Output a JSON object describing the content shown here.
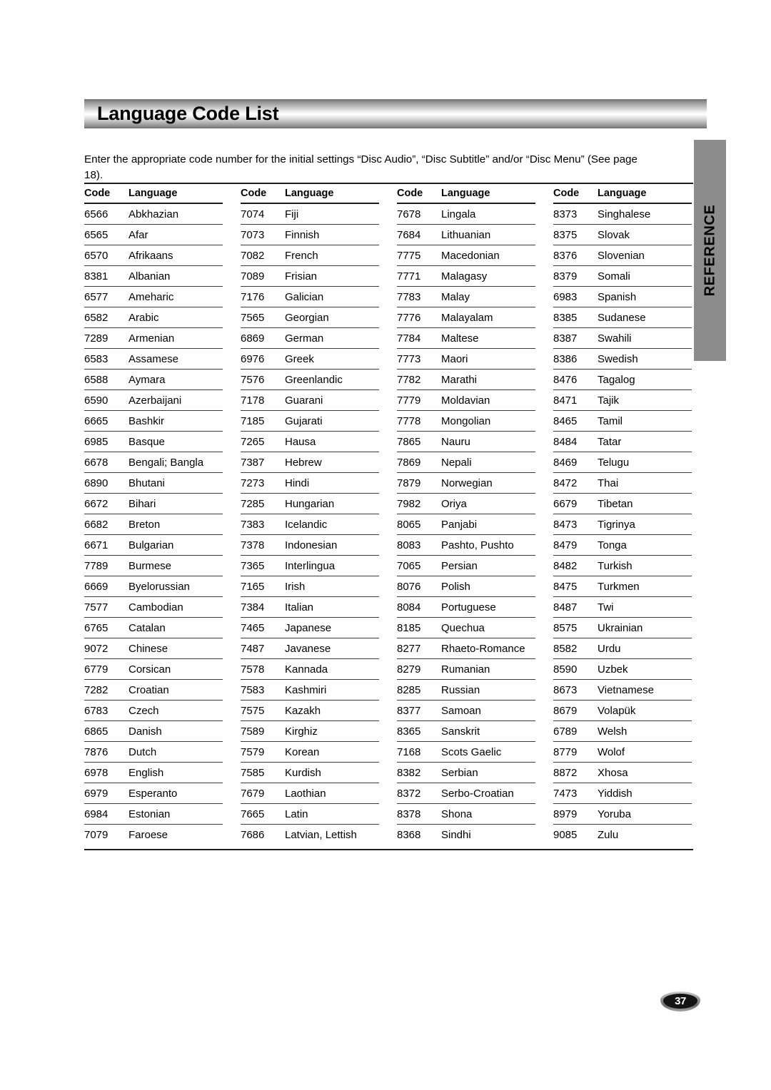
{
  "page": {
    "title": "Language Code List",
    "intro": "Enter the appropriate code number for the initial settings “Disc Audio”, “Disc Subtitle” and/or “Disc Menu” (See page 18).",
    "side_tab_label": "REFERENCE",
    "page_number": "37",
    "colors": {
      "side_tab_background": "#8c8c8c",
      "rule": "#1a1a1a",
      "text": "#000000",
      "badge_background": "#141414",
      "badge_text": "#ffffff"
    }
  },
  "table": {
    "headers": {
      "code": "Code",
      "language": "Language"
    },
    "columns": [
      {
        "rows": [
          {
            "code": "6566",
            "language": "Abkhazian"
          },
          {
            "code": "6565",
            "language": "Afar"
          },
          {
            "code": "6570",
            "language": "Afrikaans"
          },
          {
            "code": "8381",
            "language": "Albanian"
          },
          {
            "code": "6577",
            "language": "Ameharic"
          },
          {
            "code": "6582",
            "language": "Arabic"
          },
          {
            "code": "7289",
            "language": "Armenian"
          },
          {
            "code": "6583",
            "language": "Assamese"
          },
          {
            "code": "6588",
            "language": "Aymara"
          },
          {
            "code": "6590",
            "language": "Azerbaijani"
          },
          {
            "code": "6665",
            "language": "Bashkir"
          },
          {
            "code": "6985",
            "language": "Basque"
          },
          {
            "code": "6678",
            "language": "Bengali; Bangla"
          },
          {
            "code": "6890",
            "language": "Bhutani"
          },
          {
            "code": "6672",
            "language": "Bihari"
          },
          {
            "code": "6682",
            "language": "Breton"
          },
          {
            "code": "6671",
            "language": "Bulgarian"
          },
          {
            "code": "7789",
            "language": "Burmese"
          },
          {
            "code": "6669",
            "language": "Byelorussian"
          },
          {
            "code": "7577",
            "language": "Cambodian"
          },
          {
            "code": "6765",
            "language": "Catalan"
          },
          {
            "code": "9072",
            "language": "Chinese"
          },
          {
            "code": "6779",
            "language": "Corsican"
          },
          {
            "code": "7282",
            "language": "Croatian"
          },
          {
            "code": "6783",
            "language": "Czech"
          },
          {
            "code": "6865",
            "language": "Danish"
          },
          {
            "code": "7876",
            "language": "Dutch"
          },
          {
            "code": "6978",
            "language": "English"
          },
          {
            "code": "6979",
            "language": "Esperanto"
          },
          {
            "code": "6984",
            "language": "Estonian"
          },
          {
            "code": "7079",
            "language": "Faroese"
          }
        ]
      },
      {
        "rows": [
          {
            "code": "7074",
            "language": "Fiji"
          },
          {
            "code": "7073",
            "language": "Finnish"
          },
          {
            "code": "7082",
            "language": "French"
          },
          {
            "code": "7089",
            "language": "Frisian"
          },
          {
            "code": "7176",
            "language": "Galician"
          },
          {
            "code": "7565",
            "language": "Georgian"
          },
          {
            "code": "6869",
            "language": "German"
          },
          {
            "code": "6976",
            "language": "Greek"
          },
          {
            "code": "7576",
            "language": "Greenlandic"
          },
          {
            "code": "7178",
            "language": "Guarani"
          },
          {
            "code": "7185",
            "language": "Gujarati"
          },
          {
            "code": "7265",
            "language": "Hausa"
          },
          {
            "code": "7387",
            "language": "Hebrew"
          },
          {
            "code": "7273",
            "language": "Hindi"
          },
          {
            "code": "7285",
            "language": "Hungarian"
          },
          {
            "code": "7383",
            "language": "Icelandic"
          },
          {
            "code": "7378",
            "language": "Indonesian"
          },
          {
            "code": "7365",
            "language": "Interlingua"
          },
          {
            "code": "7165",
            "language": "Irish"
          },
          {
            "code": "7384",
            "language": "Italian"
          },
          {
            "code": "7465",
            "language": "Japanese"
          },
          {
            "code": "7487",
            "language": "Javanese"
          },
          {
            "code": "7578",
            "language": "Kannada"
          },
          {
            "code": "7583",
            "language": "Kashmiri"
          },
          {
            "code": "7575",
            "language": "Kazakh"
          },
          {
            "code": "7589",
            "language": "Kirghiz"
          },
          {
            "code": "7579",
            "language": "Korean"
          },
          {
            "code": "7585",
            "language": "Kurdish"
          },
          {
            "code": "7679",
            "language": "Laothian"
          },
          {
            "code": "7665",
            "language": "Latin"
          },
          {
            "code": "7686",
            "language": "Latvian, Lettish"
          }
        ]
      },
      {
        "rows": [
          {
            "code": "7678",
            "language": "Lingala"
          },
          {
            "code": "7684",
            "language": "Lithuanian"
          },
          {
            "code": "7775",
            "language": "Macedonian"
          },
          {
            "code": "7771",
            "language": "Malagasy"
          },
          {
            "code": "7783",
            "language": "Malay"
          },
          {
            "code": "7776",
            "language": "Malayalam"
          },
          {
            "code": "7784",
            "language": "Maltese"
          },
          {
            "code": "7773",
            "language": "Maori"
          },
          {
            "code": "7782",
            "language": "Marathi"
          },
          {
            "code": "7779",
            "language": "Moldavian"
          },
          {
            "code": "7778",
            "language": "Mongolian"
          },
          {
            "code": "7865",
            "language": "Nauru"
          },
          {
            "code": "7869",
            "language": "Nepali"
          },
          {
            "code": "7879",
            "language": "Norwegian"
          },
          {
            "code": "7982",
            "language": "Oriya"
          },
          {
            "code": "8065",
            "language": "Panjabi"
          },
          {
            "code": "8083",
            "language": "Pashto, Pushto"
          },
          {
            "code": "7065",
            "language": "Persian"
          },
          {
            "code": "8076",
            "language": "Polish"
          },
          {
            "code": "8084",
            "language": "Portuguese"
          },
          {
            "code": "8185",
            "language": "Quechua"
          },
          {
            "code": "8277",
            "language": "Rhaeto-Romance"
          },
          {
            "code": "8279",
            "language": "Rumanian"
          },
          {
            "code": "8285",
            "language": "Russian"
          },
          {
            "code": "8377",
            "language": "Samoan"
          },
          {
            "code": "8365",
            "language": "Sanskrit"
          },
          {
            "code": "7168",
            "language": "Scots Gaelic"
          },
          {
            "code": "8382",
            "language": "Serbian"
          },
          {
            "code": "8372",
            "language": "Serbo-Croatian"
          },
          {
            "code": "8378",
            "language": "Shona"
          },
          {
            "code": "8368",
            "language": "Sindhi"
          }
        ]
      },
      {
        "rows": [
          {
            "code": "8373",
            "language": "Singhalese"
          },
          {
            "code": "8375",
            "language": "Slovak"
          },
          {
            "code": "8376",
            "language": "Slovenian"
          },
          {
            "code": "8379",
            "language": "Somali"
          },
          {
            "code": "6983",
            "language": "Spanish"
          },
          {
            "code": "8385",
            "language": "Sudanese"
          },
          {
            "code": "8387",
            "language": "Swahili"
          },
          {
            "code": "8386",
            "language": "Swedish"
          },
          {
            "code": "8476",
            "language": "Tagalog"
          },
          {
            "code": "8471",
            "language": "Tajik"
          },
          {
            "code": "8465",
            "language": "Tamil"
          },
          {
            "code": "8484",
            "language": "Tatar"
          },
          {
            "code": "8469",
            "language": "Telugu"
          },
          {
            "code": "8472",
            "language": "Thai"
          },
          {
            "code": "6679",
            "language": "Tibetan"
          },
          {
            "code": "8473",
            "language": "Tigrinya"
          },
          {
            "code": "8479",
            "language": "Tonga"
          },
          {
            "code": "8482",
            "language": "Turkish"
          },
          {
            "code": "8475",
            "language": "Turkmen"
          },
          {
            "code": "8487",
            "language": "Twi"
          },
          {
            "code": "8575",
            "language": "Ukrainian"
          },
          {
            "code": "8582",
            "language": "Urdu"
          },
          {
            "code": "8590",
            "language": "Uzbek"
          },
          {
            "code": "8673",
            "language": "Vietnamese"
          },
          {
            "code": "8679",
            "language": "Volapük"
          },
          {
            "code": "6789",
            "language": "Welsh"
          },
          {
            "code": "8779",
            "language": "Wolof"
          },
          {
            "code": "8872",
            "language": "Xhosa"
          },
          {
            "code": "7473",
            "language": "Yiddish"
          },
          {
            "code": "8979",
            "language": "Yoruba"
          },
          {
            "code": "9085",
            "language": "Zulu"
          }
        ]
      }
    ]
  }
}
